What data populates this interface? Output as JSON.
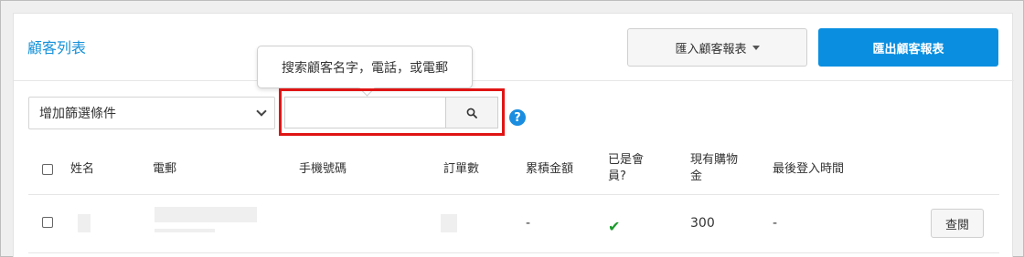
{
  "header": {
    "title": "顧客列表",
    "import_label": "匯入顧客報表",
    "export_label": "匯出顧客報表"
  },
  "toolbar": {
    "filter_label": "增加篩選條件",
    "search_value": "",
    "tooltip": "搜索顧客名字，電話，或電郵",
    "help_symbol": "?"
  },
  "table": {
    "columns": [
      "姓名",
      "電郵",
      "手機號碼",
      "訂單數",
      "累積金額",
      "已是會\n員?",
      "現有購物\n金",
      "最後登入時間"
    ],
    "rows": [
      {
        "accumulated": "-",
        "is_member": "✔",
        "credit": "300",
        "last_login": "-",
        "action": "查閱"
      }
    ]
  },
  "colors": {
    "accent": "#1591d9",
    "export_button": "#0a8fe0",
    "highlight": "#e01414",
    "member_check": "#1c9a2c"
  }
}
